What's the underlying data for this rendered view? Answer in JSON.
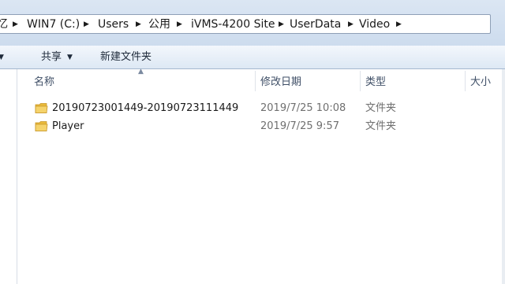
{
  "address_bar": {
    "crumbs": [
      "忆",
      "WIN7 (C:)",
      "Users",
      "公用",
      "iVMS-4200 Site",
      "UserData",
      "Video"
    ]
  },
  "toolbar": {
    "share_label": "共享",
    "new_folder_label": "新建文件夹"
  },
  "columns": {
    "name": "名称",
    "date_modified": "修改日期",
    "type": "类型",
    "size": "大小"
  },
  "files": [
    {
      "name": "20190723001449-20190723111449",
      "date": "2019/7/25 10:08",
      "type": "文件夹"
    },
    {
      "name": "Player",
      "date": "2019/7/25 9:57",
      "type": "文件夹"
    }
  ],
  "colors": {
    "folder": "#e8b93a",
    "header_text": "#3e4e66",
    "muted_text": "#6f6f6f"
  }
}
